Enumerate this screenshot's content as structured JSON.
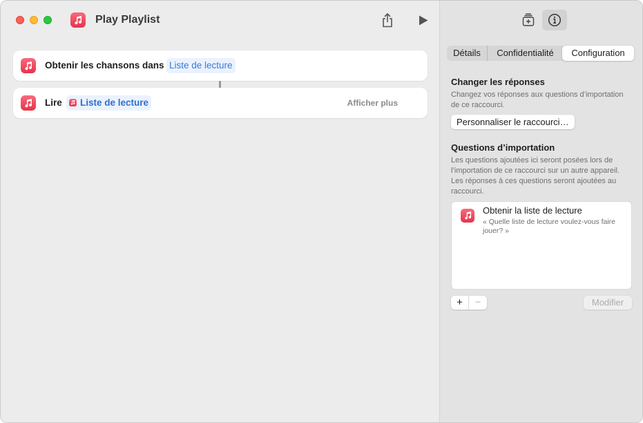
{
  "window": {
    "title": "Play Playlist"
  },
  "editor": {
    "actions": [
      {
        "label": "Obtenir les chansons dans",
        "token": "Liste de lecture"
      },
      {
        "label": "Lire",
        "token": "Liste de lecture",
        "more": "Afficher plus"
      }
    ]
  },
  "inspector": {
    "tabs": [
      "Détails",
      "Confidentialité",
      "Configuration"
    ],
    "selected_tab": "Configuration",
    "change_answers": {
      "title": "Changer les réponses",
      "description": "Changez vos réponses aux questions d’importation de ce raccourci.",
      "button": "Personnaliser le raccourci…"
    },
    "import_questions": {
      "title": "Questions d’importation",
      "description": "Les questions ajoutées ici seront posées lors de l’importation de ce raccourci sur un autre appareil. Les réponses à ces questions seront ajoutées au raccourci.",
      "items": [
        {
          "title": "Obtenir la liste de lecture",
          "question": "« Quelle liste de lecture voulez-vous faire jouer? »"
        }
      ],
      "add_label": "+",
      "remove_label": "−",
      "modify_label": "Modifier"
    }
  },
  "icons": {
    "app": "music-note-icon",
    "share": "share-icon",
    "run": "play-icon",
    "library": "add-to-library-icon",
    "info": "info-icon"
  },
  "colors": {
    "music_red": "#e7334b",
    "token_blue": "#3a7bd5"
  }
}
